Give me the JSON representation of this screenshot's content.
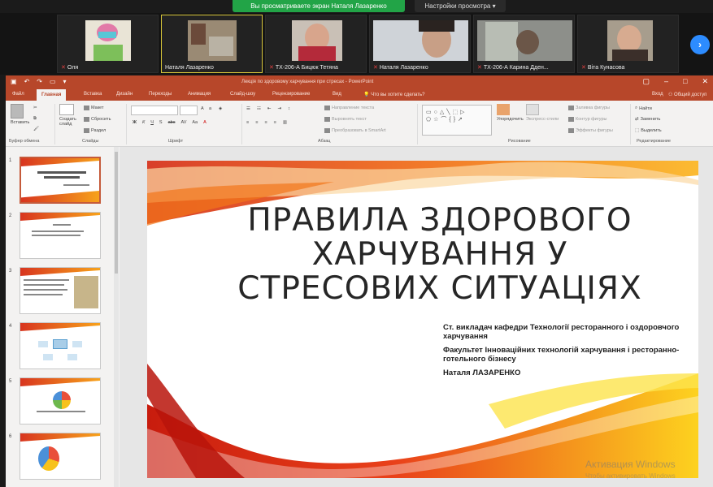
{
  "zoom": {
    "share_banner": "Вы просматриваете экран Наталя Лазаренко",
    "view_options": "Настройки просмотра",
    "participants": [
      {
        "name": "Оля",
        "muted": true
      },
      {
        "name": "Наталя Лазаренко",
        "muted": false
      },
      {
        "name": "ТХ-206-А Бицюк Тетяна",
        "muted": true
      },
      {
        "name": "Наталя Лазаренко",
        "muted": true
      },
      {
        "name": "ТХ-206-А Карина Дден...",
        "muted": true
      },
      {
        "name": "Віта Кунасова",
        "muted": true
      }
    ]
  },
  "ppt": {
    "doc_title": "Лекція по здоровому харчування при стресах - PowerPoint",
    "tabs": [
      "Файл",
      "Главная",
      "Вставка",
      "Дизайн",
      "Переходы",
      "Анимация",
      "Слайд-шоу",
      "Рецензирование",
      "Вид"
    ],
    "active_tab": "Главная",
    "tell_me": "Что вы хотите сделать?",
    "signin": "Вход",
    "share": "Общий доступ",
    "ribbon": {
      "clipboard_label": "Буфер обмена",
      "paste": "Вставить",
      "new_slide": "Создать слайд",
      "layout": "Макет",
      "reset": "Сбросить",
      "section": "Раздел",
      "slides_label": "Слайды",
      "font_label": "Шрифт",
      "paragraph_label": "Абзац",
      "text_dir": "Направление текста",
      "align_text": "Выровнять текст",
      "convert_smartart": "Преобразовать в SmartArt",
      "drawing_label": "Рисование",
      "arrange": "Упорядочить",
      "quick_styles": "Экспресс-стили",
      "shape_fill": "Заливка фигуры",
      "shape_outline": "Контур фигуры",
      "shape_effects": "Эффекты фигуры",
      "find": "Найти",
      "replace": "Заменить",
      "select": "Выделить",
      "editing_label": "Редактирование"
    },
    "thumbnail_numbers": [
      "1",
      "2",
      "3",
      "4",
      "5",
      "6"
    ]
  },
  "slide": {
    "title": "ПРАВИЛА ЗДОРОВОГО ХАРЧУВАННЯ У СТРЕСОВИХ СИТУАЦІЯХ",
    "title_lines": [
      "ПРАВИЛА ЗДОРОВОГО",
      "ХАРЧУВАННЯ У",
      "СТРЕСОВИХ СИТУАЦІЯХ"
    ],
    "author_lines": [
      "Ст. викладач кафедри Технології ресторанного і оздоровчого харчування",
      "Факультет Інноваційних технологій харчування і ресторанно-готельного бізнесу",
      "Наталя ЛАЗАРЕНКО"
    ]
  },
  "watermark": {
    "line1": "Активация Windows",
    "line2": "Чтобы активировать Windows"
  },
  "colors": {
    "zoom_green": "#22a447",
    "ppt_red": "#b7472a",
    "accent_orange": "#f7a21b",
    "accent_red": "#d8351f"
  }
}
